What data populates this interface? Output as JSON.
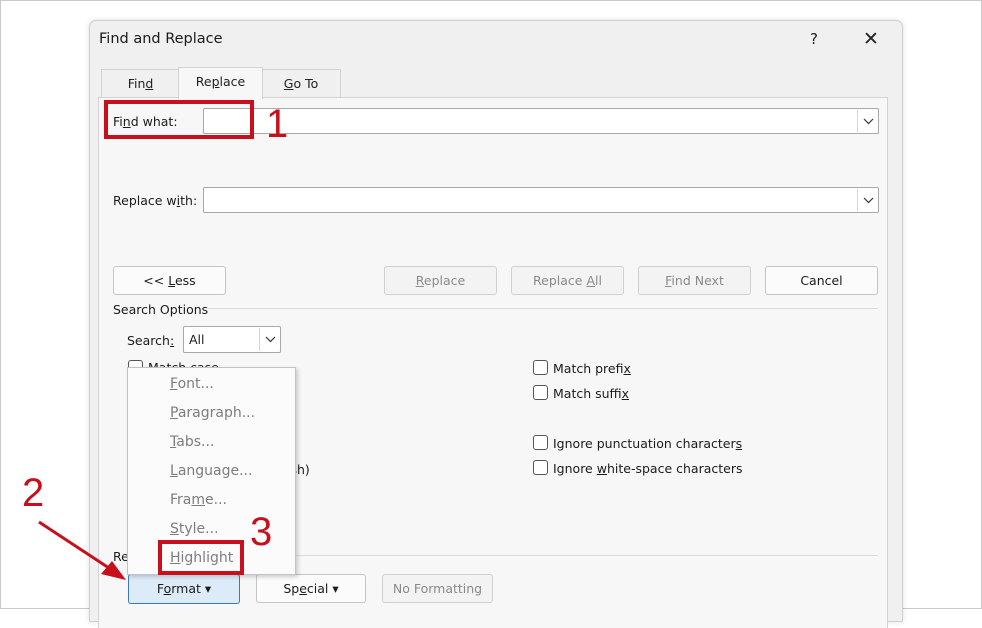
{
  "dialog": {
    "title": "Find and Replace",
    "help_label": "?",
    "close_label": "✕"
  },
  "tabs": [
    {
      "pre": "Fin",
      "acc": "d",
      "post": ""
    },
    {
      "pre": "Re",
      "acc": "p",
      "post": "lace"
    },
    {
      "pre": "",
      "acc": "G",
      "post": "o To"
    }
  ],
  "find": {
    "pre": "Fi",
    "acc": "n",
    "post": "d what:",
    "value": ""
  },
  "replace": {
    "pre": "Replace w",
    "acc": "i",
    "post": "th:",
    "value": ""
  },
  "buttons": {
    "less": {
      "pre": "<< ",
      "acc": "L",
      "post": "ess"
    },
    "replace": {
      "pre": "",
      "acc": "R",
      "post": "eplace"
    },
    "replace_all": {
      "pre": "Replace ",
      "acc": "A",
      "post": "ll"
    },
    "find_next": {
      "pre": "",
      "acc": "F",
      "post": "ind Next"
    },
    "cancel": "Cancel"
  },
  "search_options": {
    "heading": "Search Options",
    "search_label_pre": "Search",
    "search_label_acc": ":",
    "search_value": "All",
    "match_case_visible": "Match case",
    "fragment": "ish)",
    "right_checks": [
      {
        "pre": "Match prefi",
        "acc": "x",
        "post": ""
      },
      {
        "pre": "Match suffi",
        "acc": "",
        "post": "x"
      },
      {
        "pre": "Ignore punctuation character",
        "acc": "s",
        "post": ""
      },
      {
        "pre": "Ignore ",
        "acc": "w",
        "post": "hite-space characters"
      }
    ]
  },
  "replace_section_fragment": "Re",
  "bottom_buttons": {
    "format": {
      "pre": "F",
      "acc": "o",
      "post": "rmat ▾"
    },
    "special": {
      "pre": "Sp",
      "acc": "e",
      "post": "cial ▾"
    },
    "no_formatting": "No Formatting"
  },
  "format_menu": [
    {
      "pre": "",
      "acc": "F",
      "post": "ont..."
    },
    {
      "pre": "",
      "acc": "P",
      "post": "aragraph..."
    },
    {
      "pre": "",
      "acc": "T",
      "post": "abs..."
    },
    {
      "pre": "",
      "acc": "L",
      "post": "anguage..."
    },
    {
      "pre": "Fra",
      "acc": "m",
      "post": "e..."
    },
    {
      "pre": "",
      "acc": "S",
      "post": "tyle..."
    },
    {
      "pre": "",
      "acc": "H",
      "post": "ighlight"
    }
  ],
  "annotations": {
    "one": "1",
    "two": "2",
    "three": "3"
  },
  "colors": {
    "annotation_red": "#c8101c",
    "format_button_bg": "#dcebf8"
  }
}
